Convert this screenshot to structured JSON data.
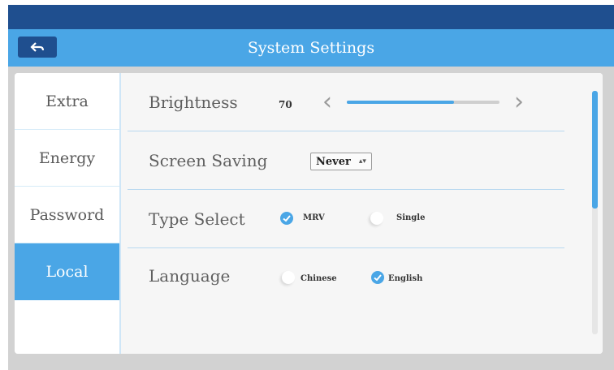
{
  "window": {
    "title": "System Settings"
  },
  "icons": {
    "back": "back-arrow-icon"
  },
  "colors": {
    "accent": "#4aa6e6",
    "header_dark": "#1f4f8f"
  },
  "sidebar": {
    "items": [
      {
        "label": "Extra",
        "active": false
      },
      {
        "label": "Energy",
        "active": false
      },
      {
        "label": "Password",
        "active": false
      },
      {
        "label": "Local",
        "active": true
      }
    ]
  },
  "settings": {
    "brightness": {
      "label": "Brightness",
      "value": "70",
      "level": 0.7
    },
    "screen_saving": {
      "label": "Screen Saving",
      "selected": "Never"
    },
    "type_select": {
      "label": "Type Select",
      "options": [
        {
          "label": "MRV",
          "checked": true
        },
        {
          "label": "Single",
          "checked": false
        }
      ]
    },
    "language": {
      "label": "Language",
      "options": [
        {
          "label": "Chinese",
          "checked": false
        },
        {
          "label": "English",
          "checked": true
        }
      ]
    }
  }
}
